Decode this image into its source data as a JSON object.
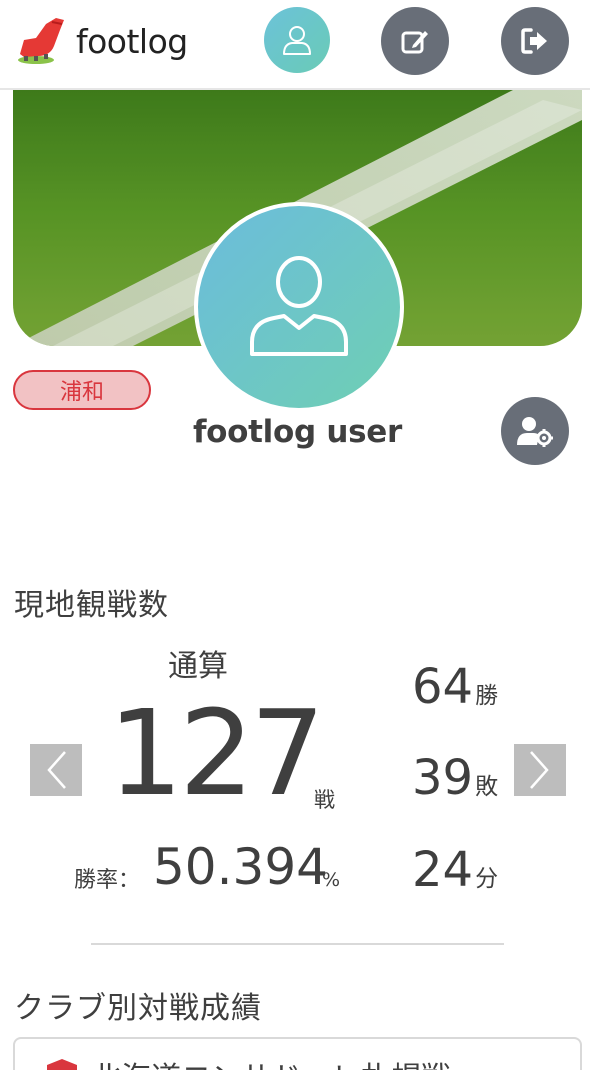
{
  "header": {
    "app_name": "footlog",
    "icons": {
      "logo": "soccer-boot-icon",
      "profile": "user-icon",
      "edit": "edit-icon",
      "logout": "sign-out-icon"
    }
  },
  "profile": {
    "club": "浦和",
    "username": "footlog user",
    "icons": {
      "avatar": "user-icon",
      "settings": "user-settings-icon"
    },
    "colors": {
      "club_badge_border": "#d9363e",
      "club_badge_bg": "#f2c2c4",
      "avatar_gradient": [
        "#6bbcdc",
        "#6fcfb3"
      ]
    }
  },
  "attendance": {
    "title": "現地観戦数",
    "period_label": "通算",
    "total": "127",
    "total_unit": "戦",
    "win_rate_label": "勝率：",
    "win_rate": "50.394",
    "win_rate_unit": "%",
    "wins": "64",
    "wins_unit": "勝",
    "losses": "39",
    "losses_unit": "敗",
    "draws": "24",
    "draws_unit": "分",
    "icons": {
      "prev": "chevron-left-icon",
      "next": "chevron-right-icon"
    }
  },
  "club_records": {
    "title": "クラブ別対戦成績",
    "first_club": "北海道コンサドーレ札幌戦"
  }
}
